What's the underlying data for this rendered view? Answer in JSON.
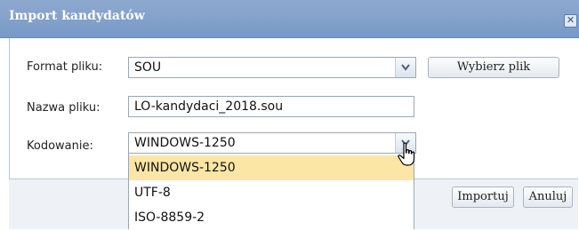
{
  "dialog": {
    "title": "Import kandydatów",
    "close_glyph": "✕"
  },
  "form": {
    "format_label": "Format pliku:",
    "format_value": "SOU",
    "choose_file_label": "Wybierz plik",
    "filename_label": "Nazwa pliku:",
    "filename_value": "LO-kandydaci_2018.sou",
    "encoding_label": "Kodowanie:",
    "encoding_value": "WINDOWS-1250"
  },
  "dropdown": {
    "options": [
      "WINDOWS-1250",
      "UTF-8",
      "ISO-8859-2"
    ],
    "selected_index": 0
  },
  "footer": {
    "import_label": "Importuj",
    "cancel_label": "Anuluj"
  },
  "colors": {
    "titlebar": "#7899c6",
    "selected_option": "#fbe6a5",
    "footer_bg": "#eef2f7"
  },
  "icons": {
    "close": "close-icon",
    "dropdown_arrow": "chevron-down-icon",
    "cursor": "hand-pointer-icon"
  }
}
